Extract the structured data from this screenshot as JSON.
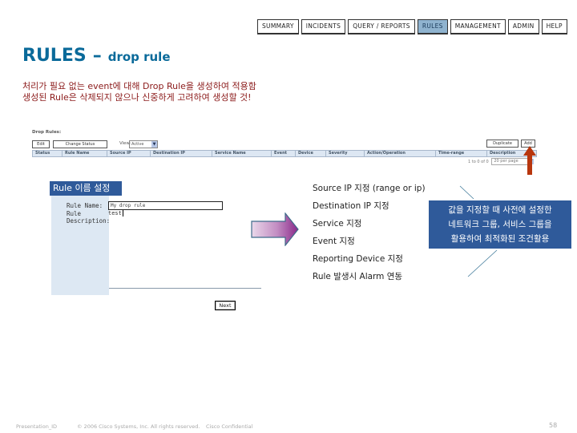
{
  "nav": {
    "tabs": [
      {
        "label": "SUMMARY",
        "active": false
      },
      {
        "label": "INCIDENTS",
        "active": false
      },
      {
        "label": "QUERY / REPORTS",
        "active": false
      },
      {
        "label": "RULES",
        "active": true
      },
      {
        "label": "MANAGEMENT",
        "active": false
      },
      {
        "label": "ADMIN",
        "active": false
      },
      {
        "label": "HELP",
        "active": false
      }
    ]
  },
  "title": {
    "main": "RULES",
    "dash": "–",
    "sub": "drop rule"
  },
  "description": [
    "처리가 필요 없는 event에 대해 Drop Rule을 생성하여 적용함",
    "생성된 Rule은 삭제되지 않으나 신중하게 고려하여 생성할 것!"
  ],
  "rules_list": {
    "label": "Drop Rules:",
    "edit_button": "Edit",
    "change_status_button": "Change Status",
    "view_label": "View:",
    "view_selected": "Active",
    "duplicate_button": "Duplicate",
    "add_button": "Add",
    "columns": [
      "Status",
      "Rule Name",
      "Source IP",
      "Destination IP",
      "Service Name",
      "Event",
      "Device",
      "Severity",
      "Action/Operation",
      "Time-range",
      "Description"
    ],
    "pager_text": "1 to 0 of 0",
    "per_page": "20 per page"
  },
  "form": {
    "section_label": "Rule 이름 설정",
    "rule_name_label": "Rule Name:",
    "rule_name_value": "My drop rule",
    "rule_desc_label_1": "Rule",
    "rule_desc_label_2": "Description:",
    "rule_desc_value": "test",
    "next_button": "Next"
  },
  "criteria": [
    "Source IP 지정 (range or ip)",
    "Destination IP 지정",
    "Service 지정",
    "Event 지정",
    "Reporting Device 지정",
    "Rule 발생시 Alarm 연동"
  ],
  "callout": {
    "lines": [
      "값을 지정할 때 사전에 설정한",
      "네트워크 그룹, 서비스 그룹을",
      "활용하여 최적화된 조건활용"
    ]
  },
  "footer": {
    "presentation_id": "Presentation_ID",
    "copyright": "© 2006 Cisco Systems, Inc. All rights reserved.",
    "confidential": "Cisco Confidential",
    "page_number": "58"
  },
  "colors": {
    "title_blue": "#0a6a9a",
    "desc_red": "#8b1a1a",
    "label_blue": "#2f5a9a",
    "active_tab": "#8fb3cf",
    "arrow_red": "#b8360e",
    "arrow_purple": "#8a2a8a"
  }
}
